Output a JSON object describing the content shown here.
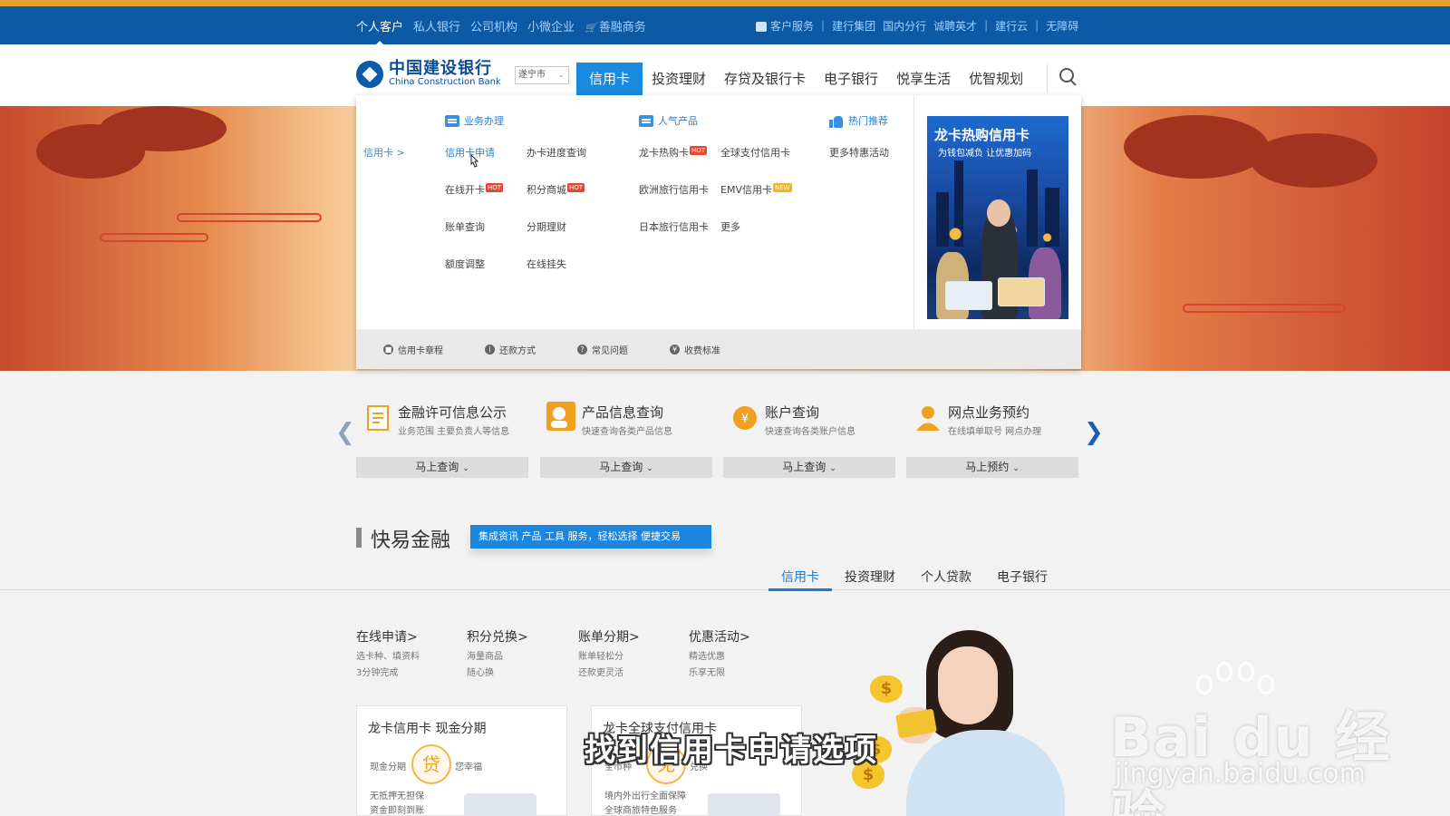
{
  "top_bar": {
    "left_links": [
      "个人客户",
      "私人银行",
      "公司机构",
      "小微企业",
      "善融商务"
    ],
    "right_links": [
      "客户服务",
      "建行集团",
      "国内分行",
      "诚聘英才",
      "建行云",
      "无障碍"
    ]
  },
  "header": {
    "logo_cn": "中国建设银行",
    "logo_en": "China Construction Bank",
    "city": "遂宁市",
    "nav": [
      "信用卡",
      "投资理财",
      "存贷及银行卡",
      "电子银行",
      "悦享生活",
      "优智规划"
    ]
  },
  "dropdown": {
    "crumb": "信用卡 >",
    "col1_head": "业务办理",
    "col1": [
      "信用卡申请",
      "办卡进度查询",
      "在线开卡",
      "积分商城",
      "账单查询",
      "分期理财",
      "额度调整",
      "在线挂失"
    ],
    "col2_head": "人气产品",
    "col2": [
      "龙卡热购卡",
      "全球支付信用卡",
      "欧洲旅行信用卡",
      "EMV信用卡",
      "日本旅行信用卡",
      "更多"
    ],
    "col3_head": "热门推荐",
    "col3": [
      "更多特惠活动"
    ],
    "tag_hot": "HOT",
    "tag_new": "NEW",
    "promo_title": "龙卡热购信用卡",
    "promo_sub": "为钱包减负  让优惠加码",
    "footer": [
      "信用卡章程",
      "还款方式",
      "常见问题",
      "收费标准"
    ]
  },
  "quick": [
    {
      "title": "金融许可信息公示",
      "sub": "业务范围 主要负责人等信息",
      "btn": "马上查询"
    },
    {
      "title": "产品信息查询",
      "sub": "快速查询各类产品信息",
      "btn": "马上查询"
    },
    {
      "title": "账户查询",
      "sub": "快速查询各类账户信息",
      "btn": "马上查询"
    },
    {
      "title": "网点业务预约",
      "sub": "在线填单取号 网点办理",
      "btn": "马上预约"
    }
  ],
  "section": {
    "title": "快易金融",
    "banner": "集成资讯 产品 工具 服务，轻松选择 便捷交易",
    "tabs": [
      "信用卡",
      "投资理财",
      "个人贷款",
      "电子银行"
    ]
  },
  "features": [
    {
      "title": "在线申请>",
      "l1": "选卡种、填资料",
      "l2": "3分钟完成"
    },
    {
      "title": "积分兑换>",
      "l1": "海量商品",
      "l2": "随心换"
    },
    {
      "title": "账单分期>",
      "l1": "账单轻松分",
      "l2": "还款更灵活"
    },
    {
      "title": "优惠活动>",
      "l1": "精选优惠",
      "l2": "乐享无限"
    }
  ],
  "cards": [
    {
      "title": "龙卡信用卡 现金分期",
      "circle": "贷",
      "left": "现金分期",
      "right": "您幸福",
      "l1": "无抵押无担保",
      "l2": "资金即刻到账"
    },
    {
      "title": "龙卡全球支付信用卡",
      "circle": "免",
      "left": "全币种",
      "right": "兑换",
      "l1": "境内外出行全面保障",
      "l2": "全球商旅特色服务"
    }
  ],
  "coin_symbol": "$",
  "subtitle": "找到信用卡申请选项",
  "watermark": {
    "text": "Bai du 经验",
    "url": "jingyan.baidu.com"
  },
  "colors": {
    "top_bar": "#0c5aa6",
    "accent": "#1a8adf",
    "orange": "#e8a12a"
  }
}
